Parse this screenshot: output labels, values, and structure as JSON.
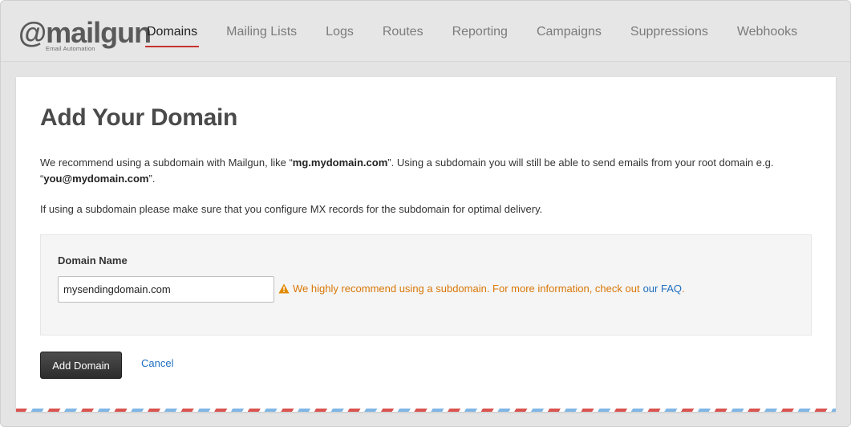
{
  "app": {
    "logo_text": "@mailgun",
    "logo_tagline": "Email Automation",
    "brand_color": "#c8332f"
  },
  "nav": {
    "items": [
      {
        "label": "Domains",
        "active": true
      },
      {
        "label": "Mailing Lists",
        "active": false
      },
      {
        "label": "Logs",
        "active": false
      },
      {
        "label": "Routes",
        "active": false
      },
      {
        "label": "Reporting",
        "active": false
      },
      {
        "label": "Campaigns",
        "active": false
      },
      {
        "label": "Suppressions",
        "active": false
      },
      {
        "label": "Webhooks",
        "active": false
      }
    ]
  },
  "main": {
    "title": "Add Your Domain",
    "intro": {
      "part1": "We recommend using a subdomain with Mailgun, like “",
      "example_subdomain": "mg.mydomain.com",
      "part2": "”. Using a subdomain you will still be able to send emails from your root domain e.g. “",
      "example_email": "you@mydomain.com",
      "part3": "”."
    },
    "mx_note": "If using a subdomain please make sure that you configure MX records for the subdomain for optimal delivery.",
    "form": {
      "label": "Domain Name",
      "value": "mysendingdomain.com",
      "warning_icon": "warning-triangle-icon",
      "warning_text": "We highly recommend using a subdomain. For more information, check out",
      "faq_link": "our FAQ",
      "warning_end": ".",
      "warning_color": "#d97706"
    },
    "actions": {
      "submit_label": "Add Domain",
      "cancel_label": "Cancel"
    }
  }
}
